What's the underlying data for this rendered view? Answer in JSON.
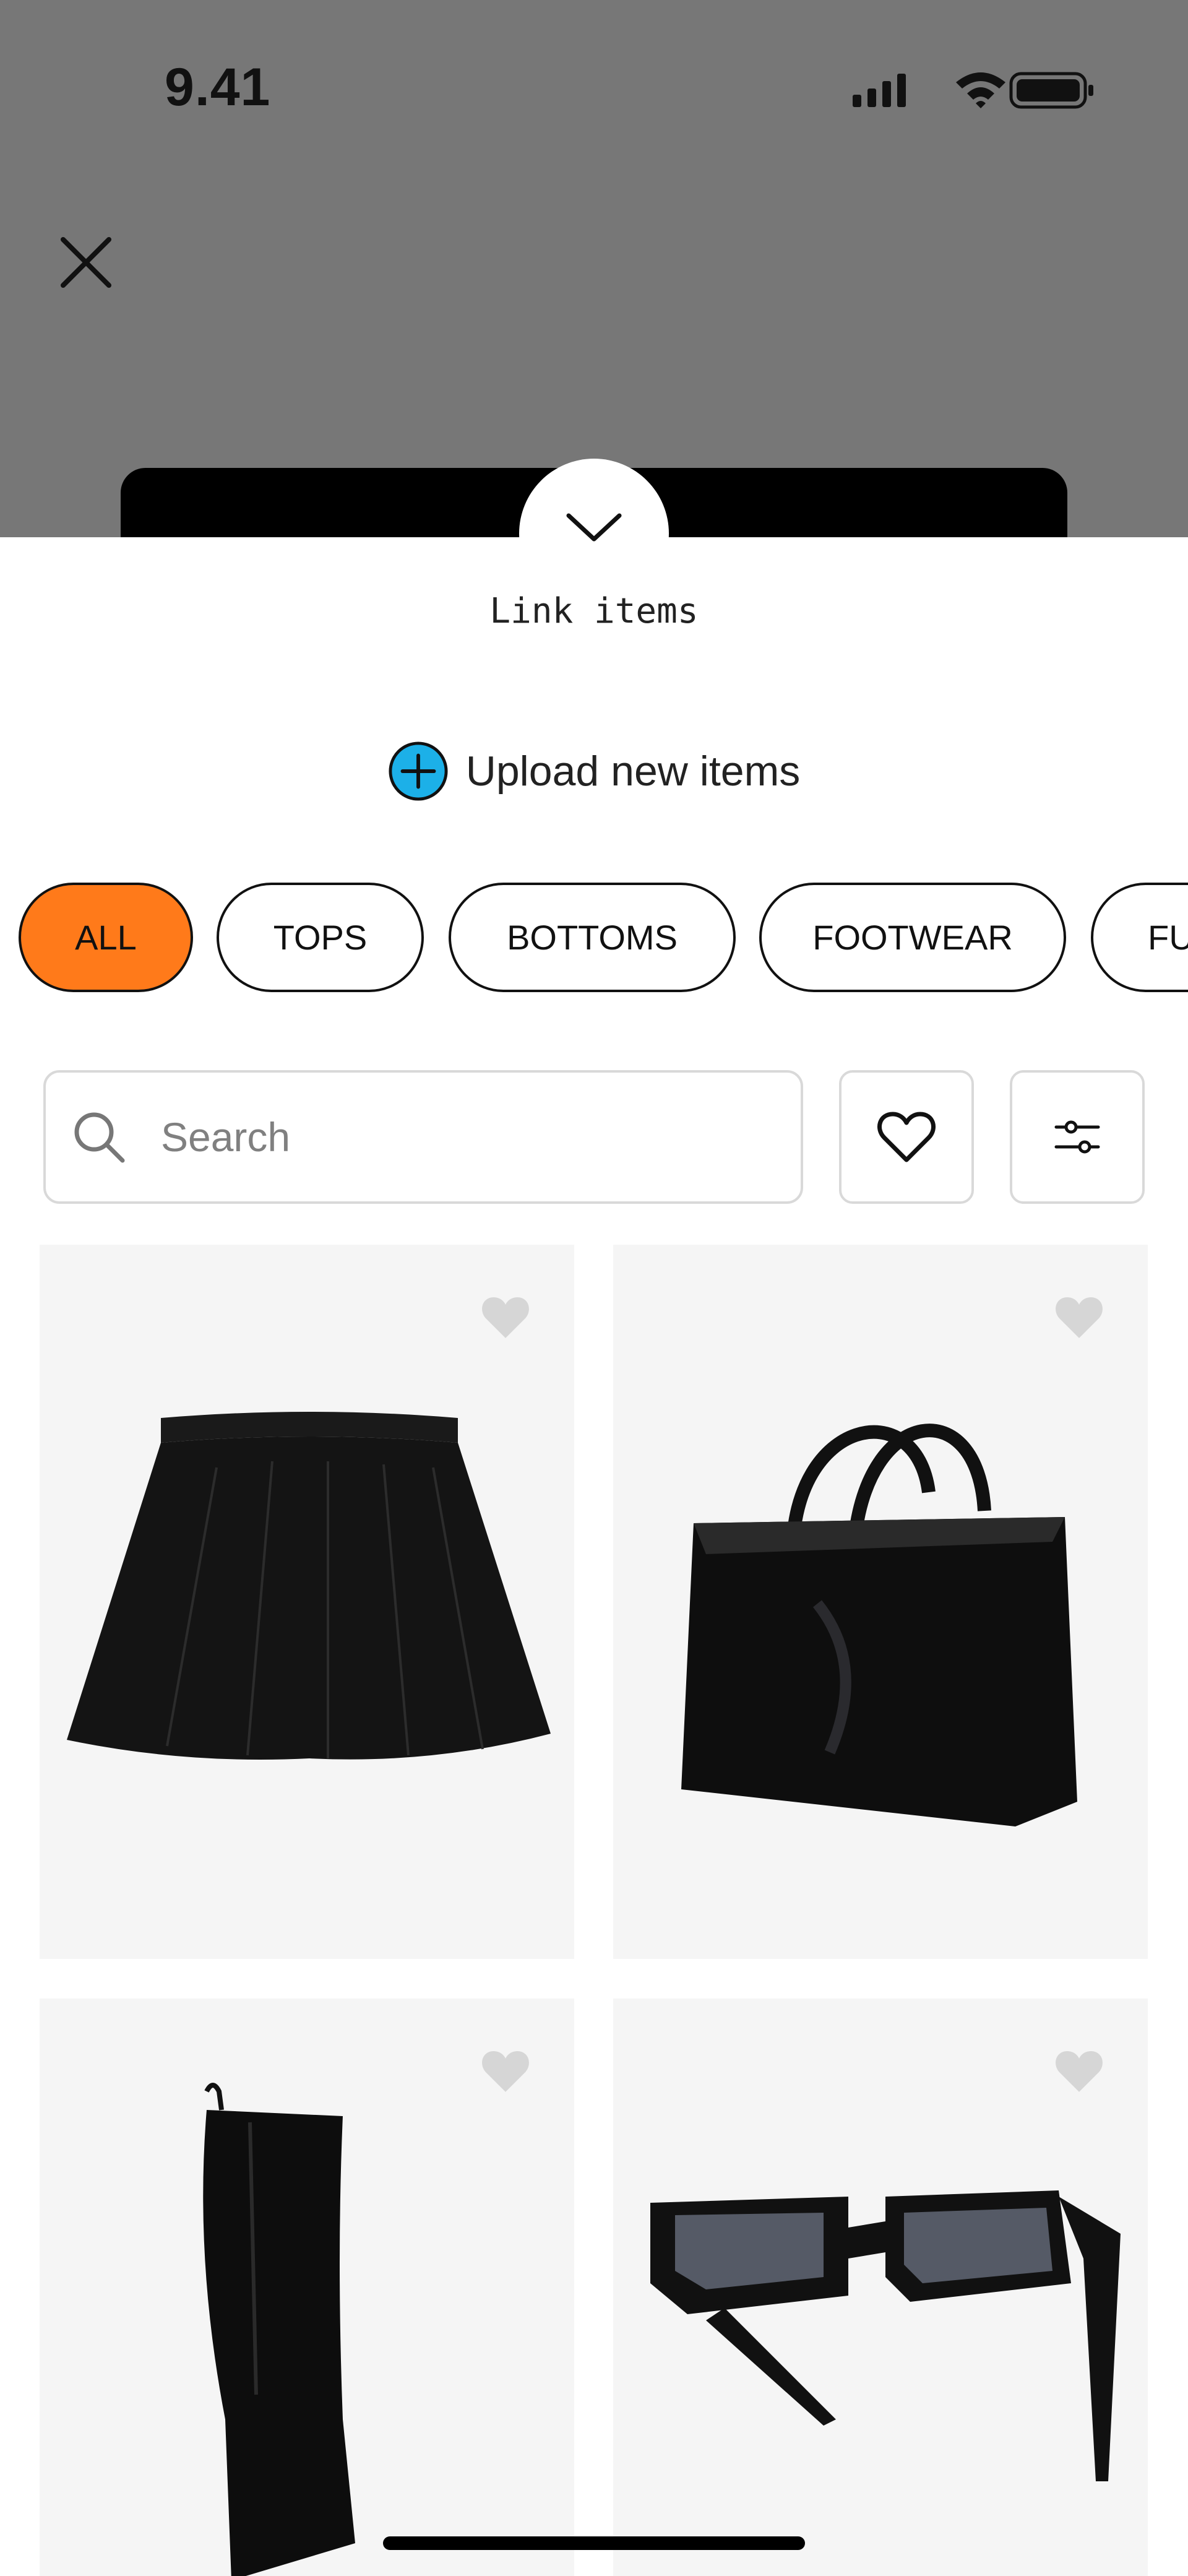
{
  "status_bar": {
    "time": "9.41",
    "icons": [
      "signal-icon",
      "wifi-icon",
      "battery-icon"
    ]
  },
  "header": {
    "close_icon": "close-icon"
  },
  "sheet": {
    "collapse_icon": "chevron-down-icon",
    "title": "Link items",
    "upload_label": "Upload new items",
    "upload_icon": "plus-circle-icon"
  },
  "filters": {
    "chips": [
      {
        "label": "ALL",
        "active": true
      },
      {
        "label": "TOPS",
        "active": false
      },
      {
        "label": "BOTTOMS",
        "active": false
      },
      {
        "label": "FOOTWEAR",
        "active": false
      },
      {
        "label": "FU",
        "active": false
      }
    ]
  },
  "search": {
    "placeholder": "Search",
    "favorites_icon": "heart-outline-icon",
    "filter_icon": "sliders-icon"
  },
  "items": [
    {
      "name": "black-pleated-skirt",
      "favorite": false
    },
    {
      "name": "black-tote-bag",
      "favorite": false
    },
    {
      "name": "black-knee-high-boots",
      "favorite": false
    },
    {
      "name": "black-sunglasses",
      "favorite": false
    }
  ],
  "colors": {
    "accent": "#FF7A1A",
    "upload_icon": "#1CB0E8",
    "overlay": "#777777",
    "tile_background": "#F5F5F5"
  }
}
